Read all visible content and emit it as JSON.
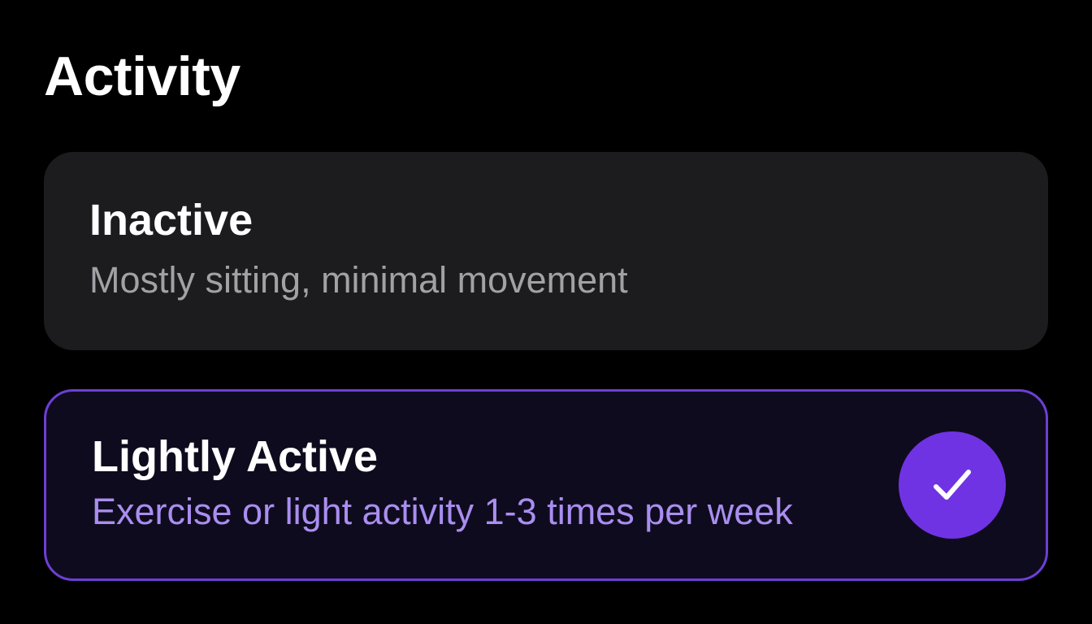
{
  "page": {
    "title": "Activity"
  },
  "options": [
    {
      "title": "Inactive",
      "description": "Mostly sitting, minimal movement",
      "selected": false
    },
    {
      "title": "Lightly Active",
      "description": "Exercise or light activity 1-3 times per week",
      "selected": true,
      "icon": "checkmark-icon"
    }
  ],
  "colors": {
    "background": "#000000",
    "card_background": "#1c1c1e",
    "selected_card_background": "#0f0b1e",
    "selected_border": "#6d3fd4",
    "accent": "#7033e4",
    "secondary_text": "#a1a1a6",
    "selected_description": "#a98ef0"
  }
}
